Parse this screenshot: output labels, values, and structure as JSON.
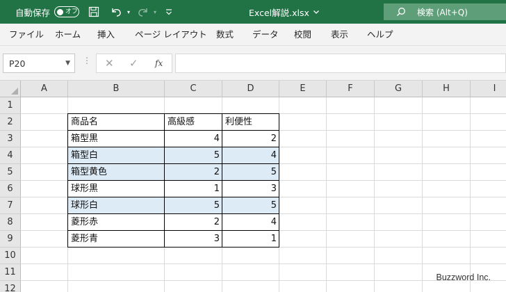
{
  "titlebar": {
    "autosave_label": "自動保存",
    "autosave_state": "オフ",
    "doc_title": "Excel解説.xlsx",
    "search_placeholder": "検索 (Alt+Q)",
    "accent": "#217346"
  },
  "ribbon": {
    "tabs": [
      "ファイル",
      "ホーム",
      "挿入",
      "ページ レイアウト",
      "数式",
      "データ",
      "校閲",
      "表示",
      "ヘルプ"
    ]
  },
  "formula_bar": {
    "name_box": "P20",
    "formula": ""
  },
  "sheet": {
    "columns": [
      "A",
      "B",
      "C",
      "D",
      "E",
      "F",
      "G",
      "H",
      "I"
    ],
    "rows": [
      "1",
      "2",
      "3",
      "4",
      "5",
      "6",
      "7",
      "8",
      "9",
      "10",
      "11",
      "12"
    ],
    "table": {
      "headers": [
        "商品名",
        "高級感",
        "利便性"
      ],
      "rows": [
        {
          "name": "箱型黒",
          "luxury": "4",
          "convenience": "2",
          "highlight": false
        },
        {
          "name": "箱型白",
          "luxury": "5",
          "convenience": "4",
          "highlight": true
        },
        {
          "name": "箱型黄色",
          "luxury": "2",
          "convenience": "5",
          "highlight": true
        },
        {
          "name": "球形黒",
          "luxury": "1",
          "convenience": "3",
          "highlight": false
        },
        {
          "name": "球形白",
          "luxury": "5",
          "convenience": "5",
          "highlight": true
        },
        {
          "name": "菱形赤",
          "luxury": "2",
          "convenience": "4",
          "highlight": false
        },
        {
          "name": "菱形青",
          "luxury": "3",
          "convenience": "1",
          "highlight": false
        }
      ],
      "highlight_color": "#ddebf7"
    }
  },
  "watermark": "Buzzword Inc."
}
